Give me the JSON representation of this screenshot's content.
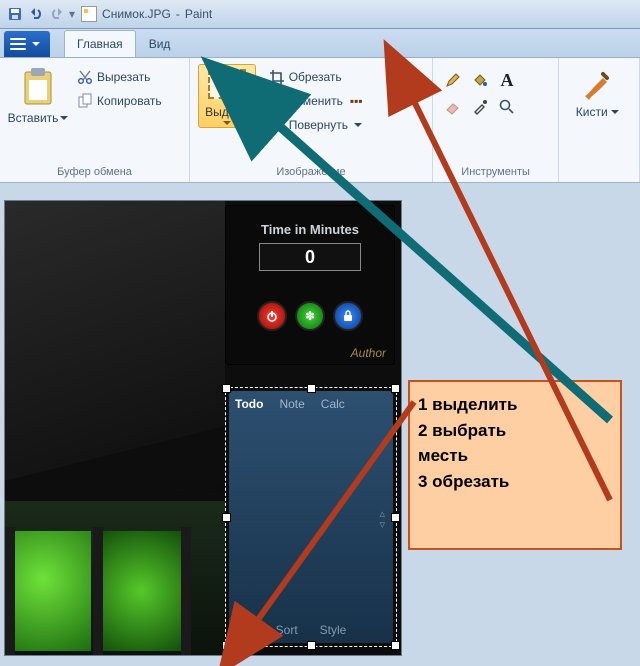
{
  "titlebar": {
    "filename": "Снимок.JPG",
    "appname": "Paint"
  },
  "tabs": {
    "home": "Главная",
    "view": "Вид"
  },
  "clipboard": {
    "paste": "Вставить",
    "cut": "Вырезать",
    "copy": "Копировать",
    "group_title": "Буфер обмена"
  },
  "image": {
    "select": "Выдели",
    "crop": "Обрезать",
    "resize": "Изменить",
    "rotate": "Повернуть",
    "group_title": "Изображение"
  },
  "tools": {
    "group_title": "Инструменты"
  },
  "brushes": {
    "label": "Кисти"
  },
  "timer_widget": {
    "title": "Time in Minutes",
    "value": "0",
    "author": "Author"
  },
  "note_widget": {
    "tab_todo": "Todo",
    "tab_note": "Note",
    "tab_calc": "Calc",
    "sort": "Sort",
    "style": "Style"
  },
  "annotation": {
    "line1": "1 выделить",
    "line2": "2 выбрать",
    "line3": "месть",
    "line4": "3 обрезать"
  }
}
